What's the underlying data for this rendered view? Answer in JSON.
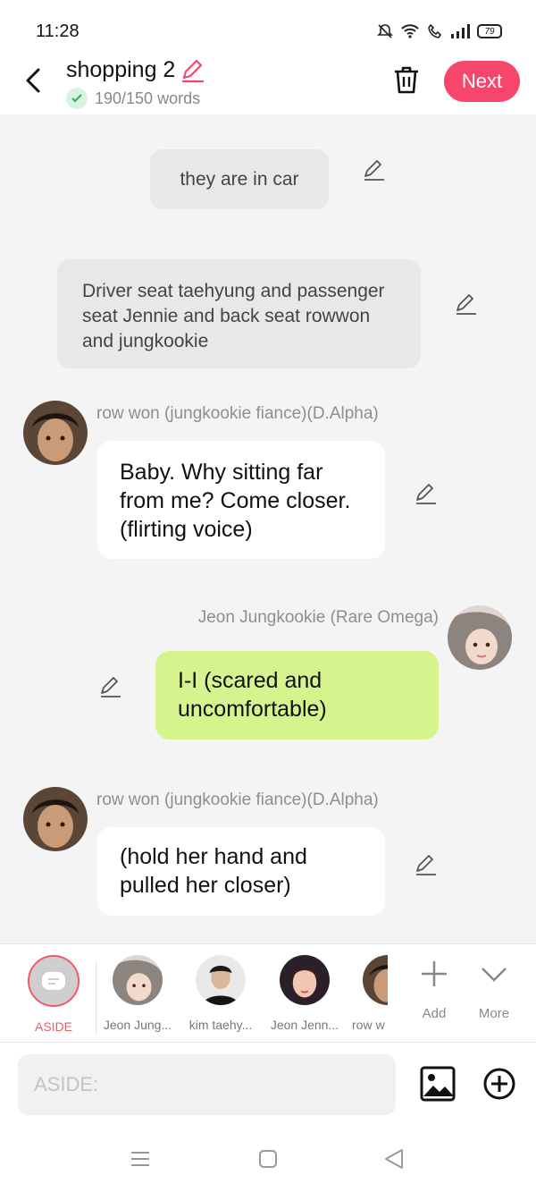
{
  "status": {
    "time": "11:28",
    "battery": "79"
  },
  "header": {
    "title": "shopping 2",
    "wordcount": "190/150 words",
    "next_label": "Next"
  },
  "messages": [
    {
      "type": "aside",
      "text": "they are in car"
    },
    {
      "type": "aside",
      "text": "Driver seat taehyung and passenger seat Jennie and back seat rowwon and jungkookie"
    },
    {
      "type": "left",
      "name": "row won (jungkookie fiance)(D.Alpha)",
      "text": "Baby. Why sitting far from me? Come closer.(flirting voice)"
    },
    {
      "type": "right",
      "name": "Jeon Jungkookie (Rare Omega)",
      "text": "I-I (scared and uncomfortable)"
    },
    {
      "type": "left",
      "name": "row won (jungkookie fiance)(D.Alpha)",
      "text": "(hold her hand and pulled her closer)"
    }
  ],
  "characters": [
    {
      "label": "ASIDE"
    },
    {
      "label": "Jeon Jung..."
    },
    {
      "label": "kim taehy..."
    },
    {
      "label": "Jeon Jenn..."
    },
    {
      "label": "row w"
    }
  ],
  "tools": {
    "add_label": "Add",
    "more_label": "More"
  },
  "input": {
    "placeholder": "ASIDE:"
  },
  "colors": {
    "accent": "#f6466c",
    "right_bubble": "#d6f48d",
    "aside_bubble": "#e8e8e8"
  }
}
